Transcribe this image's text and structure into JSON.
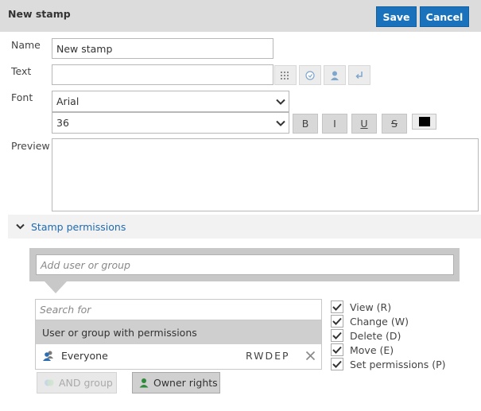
{
  "header": {
    "title": "New stamp",
    "save_label": "Save",
    "cancel_label": "Cancel"
  },
  "form": {
    "name_label": "Name",
    "name_value": "New stamp",
    "text_label": "Text",
    "text_value": "",
    "font_label": "Font",
    "font_value": "Arial",
    "size_value": "36",
    "bold_label": "B",
    "italic_label": "I",
    "underline_label": "U",
    "strike_label": "S",
    "color": "#000000",
    "preview_label": "Preview"
  },
  "permissions": {
    "section_title": "Stamp permissions",
    "add_placeholder": "Add user or group",
    "search_placeholder": "Search for",
    "list_header": "User or group with permissions",
    "entries": [
      {
        "name": "Everyone",
        "rights": "RWDEP"
      }
    ],
    "checkboxes": [
      {
        "label": "View (R)",
        "checked": true
      },
      {
        "label": "Change (W)",
        "checked": true
      },
      {
        "label": "Delete (D)",
        "checked": true
      },
      {
        "label": "Move (E)",
        "checked": true
      },
      {
        "label": "Set permissions (P)",
        "checked": true
      }
    ],
    "and_group_label": "AND group",
    "owner_rights_label": "Owner rights"
  },
  "colors": {
    "accent": "#1a72bd",
    "link": "#1f6bb1"
  }
}
